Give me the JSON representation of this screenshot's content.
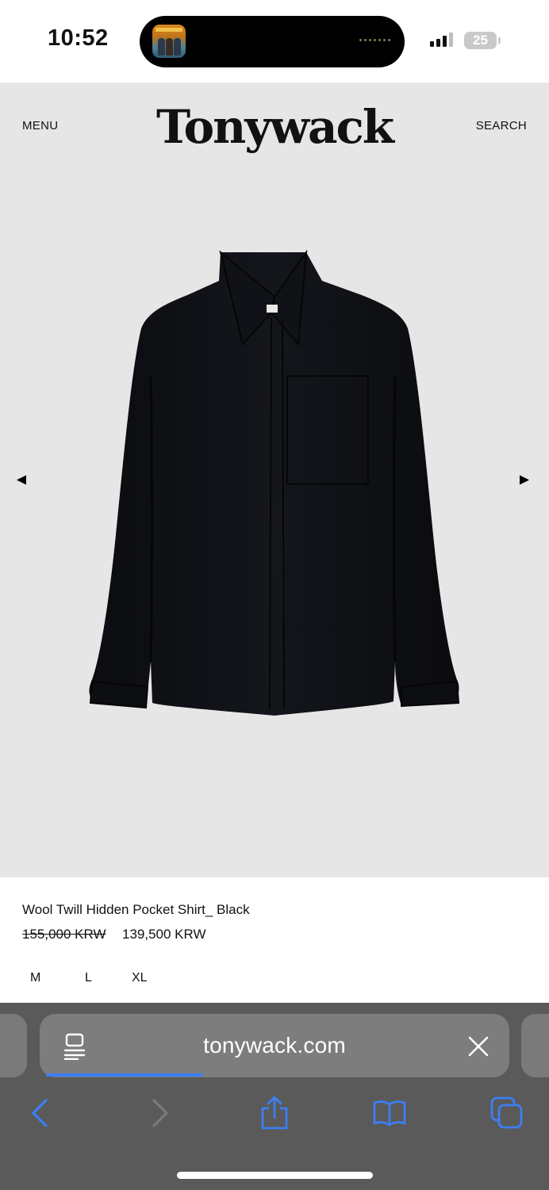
{
  "status_bar": {
    "time": "10:52",
    "battery": "25",
    "now_playing_icon": "album-art-icon",
    "signal_icon": "cellular-signal-icon"
  },
  "site": {
    "menu_label": "MENU",
    "brand": "Tonywack",
    "search_label": "SEARCH"
  },
  "gallery": {
    "prev_icon": "caret-left-icon",
    "next_icon": "caret-right-icon",
    "image_subject": "black long-sleeve shirt"
  },
  "product": {
    "name": "Wool Twill Hidden Pocket Shirt_ Black",
    "price_original": "155,000 KRW",
    "price_sale": "139,500 KRW",
    "sizes": [
      "M",
      "L",
      "XL"
    ]
  },
  "browser": {
    "url": "tonywack.com",
    "page_load_progress": 0.34,
    "toolbar": {
      "back_icon": "chevron-left-icon",
      "forward_icon": "chevron-right-icon",
      "share_icon": "share-icon",
      "bookmarks_icon": "book-icon",
      "tabs_icon": "tabs-icon"
    }
  },
  "colors": {
    "hero_background": "#e6e6e6",
    "safari_chrome": "#5a5a5a",
    "accent_blue": "#3c7ff3"
  }
}
